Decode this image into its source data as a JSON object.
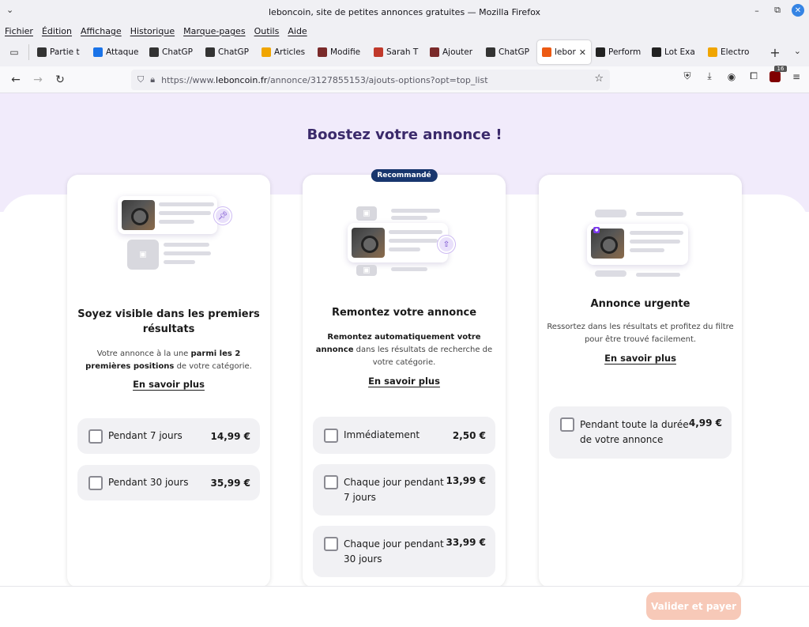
{
  "window": {
    "title": "leboncoin, site de petites annonces gratuites — Mozilla Firefox",
    "menu": [
      "Fichier",
      "Édition",
      "Affichage",
      "Historique",
      "Marque-pages",
      "Outils",
      "Aide"
    ]
  },
  "tabs": [
    {
      "label": "Partie t",
      "icon": "clock-icon",
      "color": "#333333"
    },
    {
      "label": "Attaque",
      "icon": "shield-icon",
      "color": "#1a73e8"
    },
    {
      "label": "ChatGP",
      "icon": "openai-icon",
      "color": "#333333"
    },
    {
      "label": "ChatGP",
      "icon": "openai-icon",
      "color": "#333333"
    },
    {
      "label": "Articles",
      "icon": "ec-icon",
      "color": "#f0a500"
    },
    {
      "label": "Modifie",
      "icon": "site-icon",
      "color": "#7a2a2a"
    },
    {
      "label": "Sarah T",
      "icon": "site-icon",
      "color": "#c0392b"
    },
    {
      "label": "Ajouter",
      "icon": "site-icon",
      "color": "#7a2a2a"
    },
    {
      "label": "ChatGP",
      "icon": "openai-icon",
      "color": "#333333"
    },
    {
      "label": "lebor",
      "icon": "leboncoin-icon",
      "color": "#ec5a13",
      "active": true
    },
    {
      "label": "Perform",
      "icon": "site-icon",
      "color": "#222222"
    },
    {
      "label": "Lot Exa",
      "icon": "site-icon",
      "color": "#222222"
    },
    {
      "label": "Electro",
      "icon": "ec-icon",
      "color": "#f0a500"
    }
  ],
  "url": {
    "prefix": "https://www.",
    "host": "leboncoin.fr",
    "path": "/annonce/3127855153/ajouts-options?opt=top_list"
  },
  "ublock_count": "16",
  "page": {
    "title": "Boostez votre annonce !",
    "pay_button": "Valider et payer"
  },
  "cards": [
    {
      "title": "Soyez visible dans les premiers résultats",
      "desc_pre": "Votre annonce à la une ",
      "desc_bold": "parmi les 2 premières positions",
      "desc_post": " de votre catégorie.",
      "learn_more": "En savoir plus",
      "options": [
        {
          "label": "Pendant 7 jours",
          "price": "14,99 €",
          "checked": false
        },
        {
          "label": "Pendant 30 jours",
          "price": "35,99 €",
          "checked": false
        }
      ]
    },
    {
      "badge": "Recommandé",
      "title": "Remontez votre annonce",
      "desc_pre": "",
      "desc_bold": "Remontez automatiquement votre annonce",
      "desc_post": " dans les résultats de recherche de votre catégorie.",
      "learn_more": "En savoir plus",
      "options": [
        {
          "label": "Immédiatement",
          "price": "2,50 €",
          "checked": false
        },
        {
          "label": "Chaque jour pendant 7 jours",
          "price": "13,99 €",
          "checked": false
        },
        {
          "label": "Chaque jour pendant 30 jours",
          "price": "33,99 €",
          "checked": false
        }
      ]
    },
    {
      "title": "Annonce urgente",
      "desc_pre": "Ressortez dans les résultats et profitez du filtre pour être trouvé facilement.",
      "desc_bold": "",
      "desc_post": "",
      "learn_more": "En savoir plus",
      "options": [
        {
          "label": "Pendant toute la durée de votre annonce",
          "price": "4,99 €",
          "checked": false
        }
      ]
    }
  ],
  "colors": {
    "title_purple": "#3b2a6b",
    "hero_bg": "#f1ebfb",
    "badge_navy": "#18366e",
    "pay_button_disabled": "#f7c9b8"
  }
}
